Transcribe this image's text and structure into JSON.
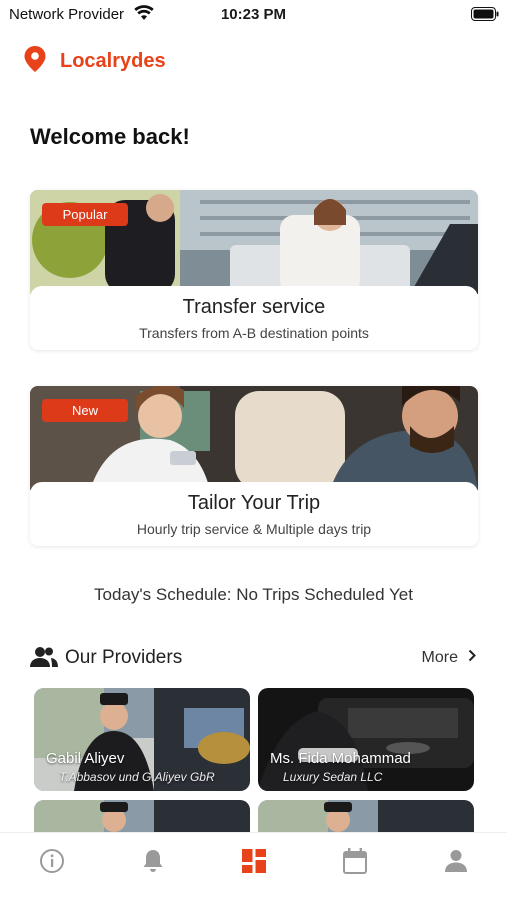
{
  "status_bar": {
    "provider": "Network Provider",
    "time": "10:23 PM"
  },
  "brand": {
    "name": "Localrydes",
    "icon": "location-pin-icon",
    "color": "#e8421a"
  },
  "welcome": "Welcome back!",
  "services": [
    {
      "badge": "Popular",
      "title": "Transfer service",
      "subtitle": "Transfers from A-B destination points"
    },
    {
      "badge": "New",
      "title": "Tailor Your Trip",
      "subtitle": "Hourly trip service & Multiple days trip"
    }
  ],
  "schedule": "Today's Schedule: No Trips Scheduled Yet",
  "providers": {
    "title": "Our Providers",
    "more": "More",
    "items": [
      {
        "name": "Gabil Aliyev",
        "company": "T.Abbasov und G.Aliyev GbR"
      },
      {
        "name": "Ms. Fida Mohammad",
        "company": "Luxury Sedan LLC"
      }
    ]
  },
  "tabbar": {
    "tabs": [
      {
        "icon": "info-icon",
        "active": false
      },
      {
        "icon": "bell-icon",
        "active": false
      },
      {
        "icon": "dashboard-icon",
        "active": true
      },
      {
        "icon": "calendar-icon",
        "active": false
      },
      {
        "icon": "profile-icon",
        "active": false
      }
    ],
    "active_color": "#e8421a",
    "inactive_color": "#9a9a9a"
  }
}
